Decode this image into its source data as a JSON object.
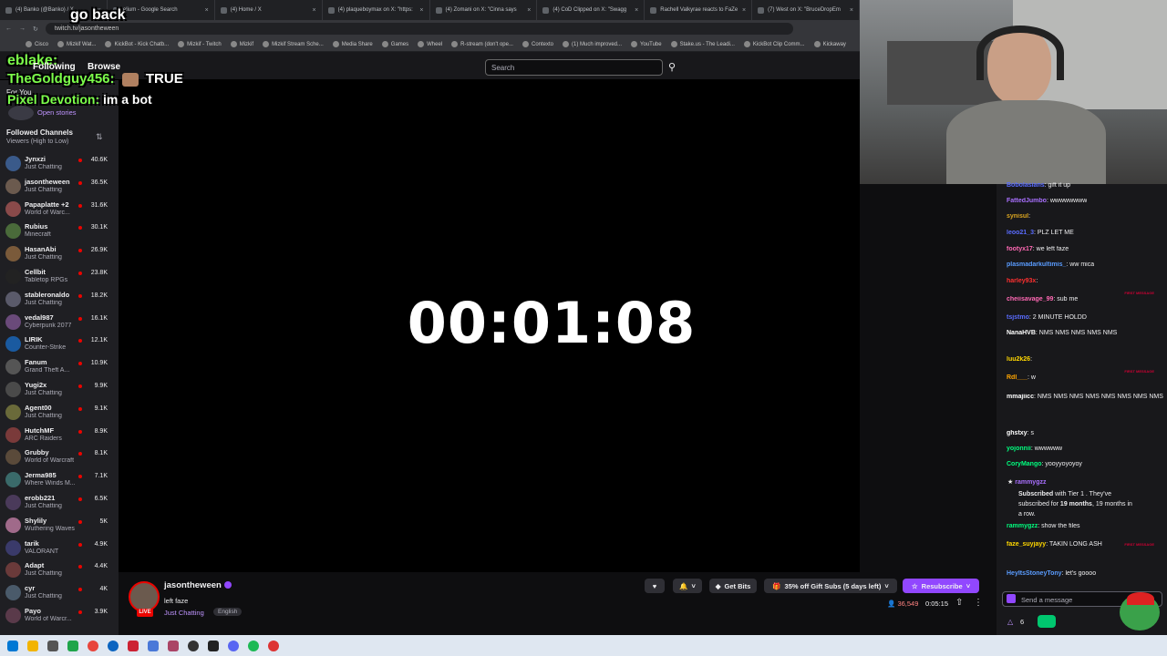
{
  "browser": {
    "tabs": [
      {
        "label": "(4) Banko (@Banko) / X"
      },
      {
        "label": "elium - Google Search"
      },
      {
        "label": "(4) Home / X"
      },
      {
        "label": "(4) plaqueboymax on X: \"https:"
      },
      {
        "label": "(4) Zomani on X: \"Cinna says"
      },
      {
        "label": "(4) CoD Clipped on X: \"Swagg"
      },
      {
        "label": "Rachell Valkyrae reacts to FaZe"
      },
      {
        "label": "(7) West on X: \"BruceDropEm"
      }
    ],
    "url": "twitch.tv/jasontheween",
    "bookmarks": [
      "Cisco",
      "Mizkif Wat...",
      "KickBot - Kick Chatb...",
      "Mizkif - Twitch",
      "Mizkif",
      "Mizkif Stream Sche...",
      "Media Share",
      "Games",
      "Wheel",
      "R-stream (don't ope...",
      "Contexto",
      "(1) Much improved...",
      "YouTube",
      "Stake.us - The Leadi...",
      "KickBot Clip Comm...",
      "Kickaway"
    ]
  },
  "search": {
    "placeholder": "Search"
  },
  "overlay": {
    "line1_user": "eblake:",
    "line1_text": "go back",
    "line2_user": "Following",
    "line2_extra": "Browse",
    "line3_user": "TheGoldguy456:",
    "line3_text": "TRUE",
    "line4_user": "Pixel Devotion:",
    "line4_text": "im a bot",
    "for_you": "For You",
    "open_stories": "Open stories"
  },
  "sidebar": {
    "header": "Followed Channels",
    "sort": "Viewers (High to Low)",
    "channels": [
      {
        "name": "Jynxzi",
        "game": "Just Chatting",
        "viewers": "40.6K"
      },
      {
        "name": "jasontheween",
        "game": "Just Chatting",
        "viewers": "36.5K"
      },
      {
        "name": "Papaplatte +2",
        "game": "World of Warc...",
        "viewers": "31.6K"
      },
      {
        "name": "Rubius",
        "game": "Minecraft",
        "viewers": "30.1K"
      },
      {
        "name": "HasanAbi",
        "game": "Just Chatting",
        "viewers": "26.9K"
      },
      {
        "name": "Cellbit",
        "game": "Tabletop RPGs",
        "viewers": "23.8K"
      },
      {
        "name": "stableronaldo",
        "game": "Just Chatting",
        "viewers": "18.2K"
      },
      {
        "name": "vedal987",
        "game": "Cyberpunk 2077",
        "viewers": "16.1K"
      },
      {
        "name": "LIRIK",
        "game": "Counter-Strike",
        "viewers": "12.1K"
      },
      {
        "name": "Fanum",
        "game": "Grand Theft A...",
        "viewers": "10.9K"
      },
      {
        "name": "Yugi2x",
        "game": "Just Chatting",
        "viewers": "9.9K"
      },
      {
        "name": "Agent00",
        "game": "Just Chatting",
        "viewers": "9.1K"
      },
      {
        "name": "HutchMF",
        "game": "ARC Raiders",
        "viewers": "8.9K"
      },
      {
        "name": "Grubby",
        "game": "World of Warcraft",
        "viewers": "8.1K"
      },
      {
        "name": "Jerma985",
        "game": "Where Winds M...",
        "viewers": "7.1K"
      },
      {
        "name": "erobb221",
        "game": "Just Chatting",
        "viewers": "6.5K"
      },
      {
        "name": "Shylily",
        "game": "Wuthering Waves",
        "viewers": "5K"
      },
      {
        "name": "tarik",
        "game": "VALORANT",
        "viewers": "4.9K"
      },
      {
        "name": "Adapt",
        "game": "Just Chatting",
        "viewers": "4.4K"
      },
      {
        "name": "cyr",
        "game": "Just Chatting",
        "viewers": "4K"
      },
      {
        "name": "Payo",
        "game": "World of Warcr...",
        "viewers": "3.9K"
      }
    ]
  },
  "stream": {
    "timer": "00:01:08",
    "channel": "jasontheween",
    "title": "left faze",
    "category": "Just Chatting",
    "tag": "English",
    "live": "LIVE",
    "viewers": "36,549",
    "uptime": "0:05:15",
    "get_bits": "Get Bits",
    "gift_subs": "35% off Gift Subs (5 days left)",
    "resubscribe": "Resubscribe"
  },
  "chat": {
    "messages": [
      {
        "user": "Bobolasians",
        "text": ": gift it up",
        "color": "#5a6cff"
      },
      {
        "user": "FattedJumbo",
        "text": ": wwwwwwww",
        "color": "#a970ff"
      },
      {
        "user": "synisul",
        "text": ":",
        "color": "#daa520"
      },
      {
        "user": "leoo21_3",
        "text": ": PLZ LET ME",
        "color": "#5a6cff"
      },
      {
        "user": "footyx17",
        "text": ": we left faze",
        "color": "#ff69b4"
      },
      {
        "user": "plasmadarkultimis_",
        "text": ": ww mica",
        "color": "#5a9cff"
      },
      {
        "user": "harley93x",
        "text": ":",
        "color": "#ff3030"
      },
      {
        "user": "cheiisavage_99",
        "text": ": sub me",
        "color": "#ff69b4"
      },
      {
        "user": "tsjstmo",
        "text": ": 2 MINUTE HOLDD",
        "color": "#5a6cff"
      },
      {
        "user": "NanaHVB",
        "text": ": NMS NMS NMS NMS NMS",
        "color": "#ffffff"
      },
      {
        "user": "luu2k26",
        "text": ":",
        "color": "#ffd700"
      },
      {
        "user": "Rdl___",
        "text": ": w",
        "color": "#ffa500"
      },
      {
        "user": "mmajiicc",
        "text": ": NMS NMS NMS NMS NMS NMS NMS NMS NMS",
        "color": "#ffffff"
      },
      {
        "user": "ghstxy",
        "text": ": s",
        "color": "#ffffff"
      },
      {
        "user": "yojonnii",
        "text": ": wwwwww",
        "color": "#00ff7f"
      },
      {
        "user": "CoryMango",
        "text": ": yooyyoyoyoy",
        "color": "#00ff7f"
      },
      {
        "user": "rammygzz",
        "text": "",
        "color": "#a970ff"
      },
      {
        "user": "rammygzz",
        "text": ": show the files",
        "color": "#00ff7f"
      },
      {
        "user": "faze_suyjayy",
        "text": ": TAKIN LONG ASH",
        "color": "#ffd700"
      },
      {
        "user": "HeyItsStoneyTony",
        "text": ": let's goooo",
        "color": "#5a9cff"
      }
    ],
    "sub_notice": {
      "line1_bold": "Subscribed",
      "line1_rest": " with Tier 1 . They've",
      "line2_pre": "subscribed for ",
      "line2_bold": "19 months",
      "line2_rest": ", 19 months in",
      "line3": "a row."
    },
    "first_message": "FIRST MESSAGE",
    "send_placeholder": "Send a message",
    "points": "6"
  },
  "colors": {
    "accent": "#9147ff",
    "live": "#eb0400"
  }
}
